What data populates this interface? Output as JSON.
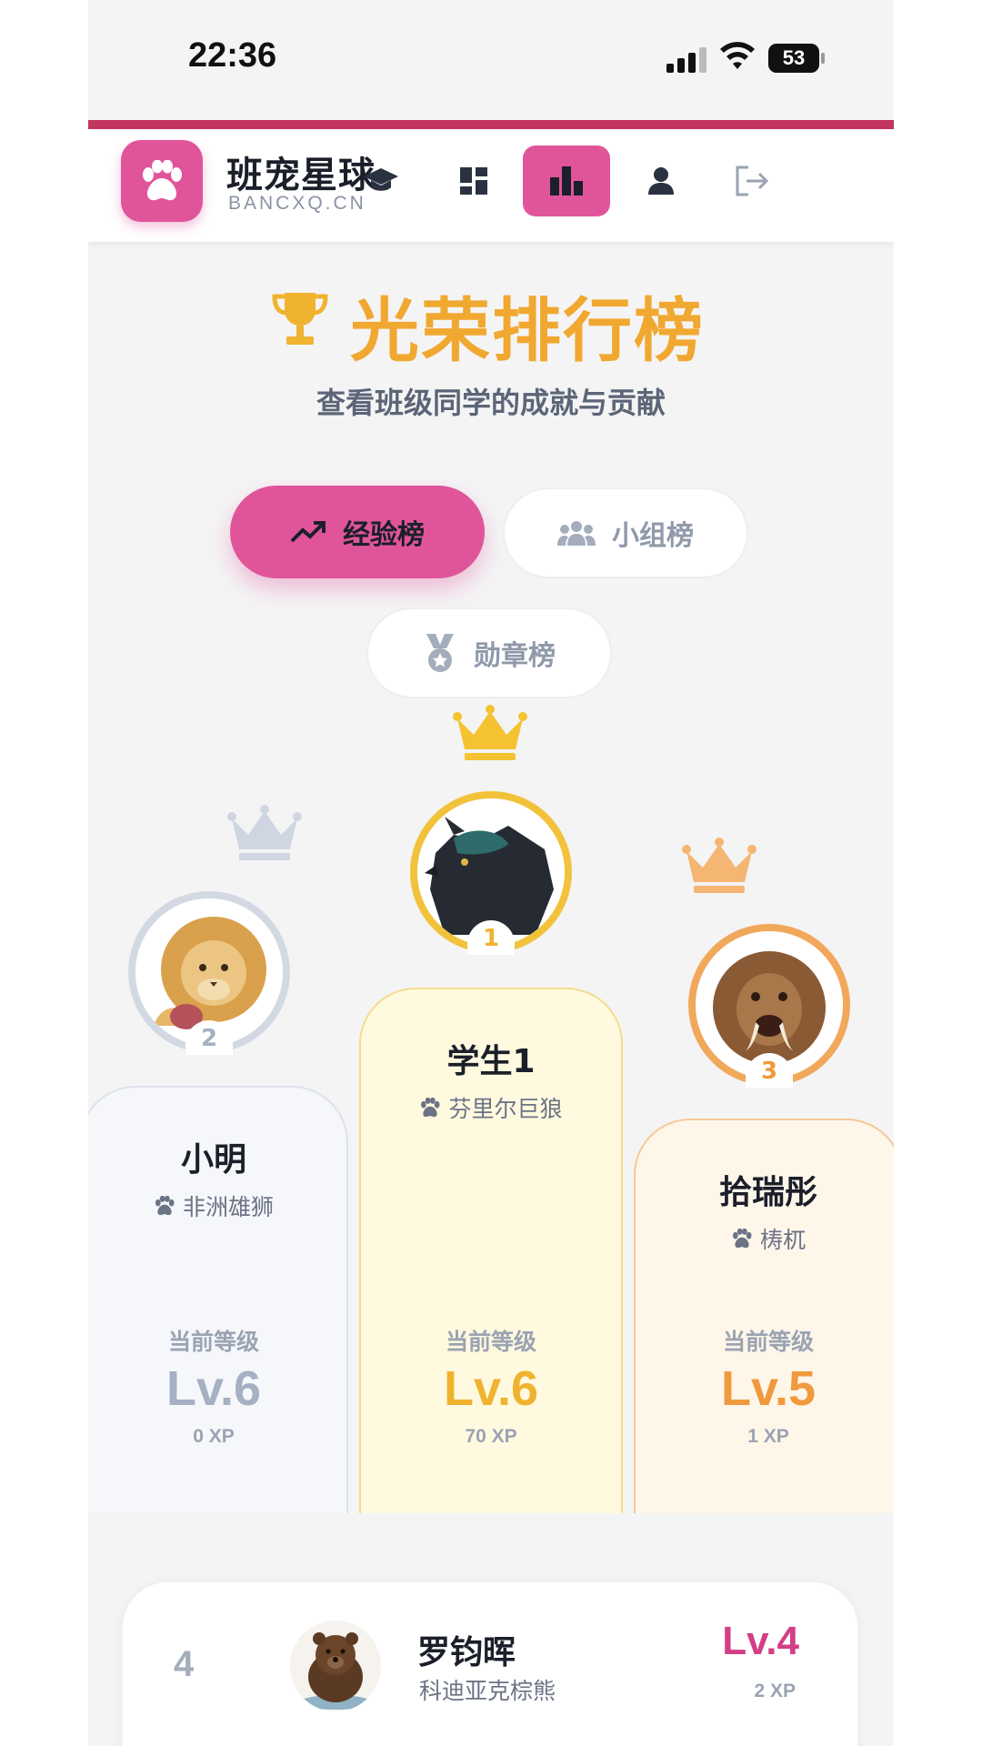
{
  "status_bar": {
    "time": "22:36",
    "battery": "53"
  },
  "header": {
    "brand_title": "班宠星球",
    "brand_subtitle": "BANCXQ.CN",
    "nav": [
      {
        "icon": "graduation-cap-icon",
        "active": false
      },
      {
        "icon": "dashboard-icon",
        "active": false
      },
      {
        "icon": "bar-chart-icon",
        "active": true
      },
      {
        "icon": "user-icon",
        "active": false
      },
      {
        "icon": "logout-icon",
        "active": false
      }
    ],
    "accent_color": "#e0559a"
  },
  "page": {
    "title": "光荣排行榜",
    "subtitle": "查看班级同学的成就与贡献",
    "title_color": "#f0a830"
  },
  "tabs": [
    {
      "label": "经验榜",
      "icon": "trending-up-icon",
      "active": true
    },
    {
      "label": "小组榜",
      "icon": "users-icon",
      "active": false
    },
    {
      "label": "勋章榜",
      "icon": "medal-icon",
      "active": false
    }
  ],
  "podium": {
    "level_label": "当前等级",
    "first": {
      "rank": "1",
      "name": "学生1",
      "species": "芬里尔巨狼",
      "level": "Lv.6",
      "xp": "70 XP",
      "color": "#f0b330"
    },
    "second": {
      "rank": "2",
      "name": "小明",
      "species": "非洲雄狮",
      "level": "Lv.6",
      "xp": "0 XP",
      "color": "#a5b0c2"
    },
    "third": {
      "rank": "3",
      "name": "拾瑞彤",
      "species": "梼杌",
      "level": "Lv.5",
      "xp": "1 XP",
      "color": "#ef9a3c"
    }
  },
  "list": [
    {
      "rank": "4",
      "name": "罗钧晖",
      "species": "科迪亚克棕熊",
      "level": "Lv.4",
      "xp": "2 XP"
    }
  ]
}
